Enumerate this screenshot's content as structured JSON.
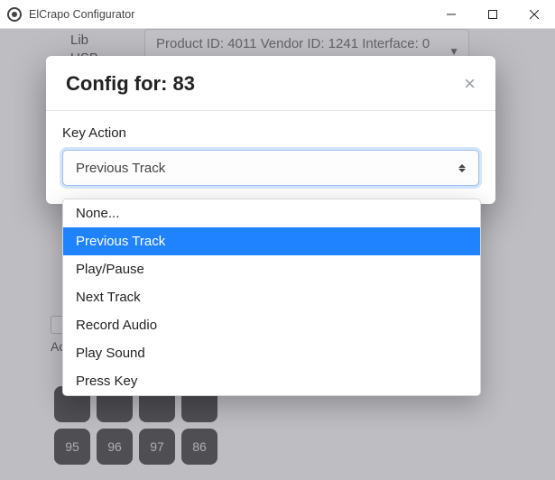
{
  "window": {
    "title": "ElCrapo Configurator"
  },
  "background": {
    "lib_label": "Lib",
    "usb_label": "USB",
    "product_select": "Product ID: 4011 Vendor ID: 1241 Interface: 0",
    "ac_label": "Ac",
    "keypad_row1": [
      "",
      "",
      "",
      ""
    ],
    "keypad_row2": [
      "95",
      "96",
      "97",
      "86"
    ]
  },
  "modal": {
    "title": "Config for: 83",
    "field_label": "Key Action",
    "selected": "Previous Track",
    "options": [
      "None...",
      "Previous Track",
      "Play/Pause",
      "Next Track",
      "Record Audio",
      "Play Sound",
      "Press Key"
    ],
    "highlighted_index": 1
  }
}
